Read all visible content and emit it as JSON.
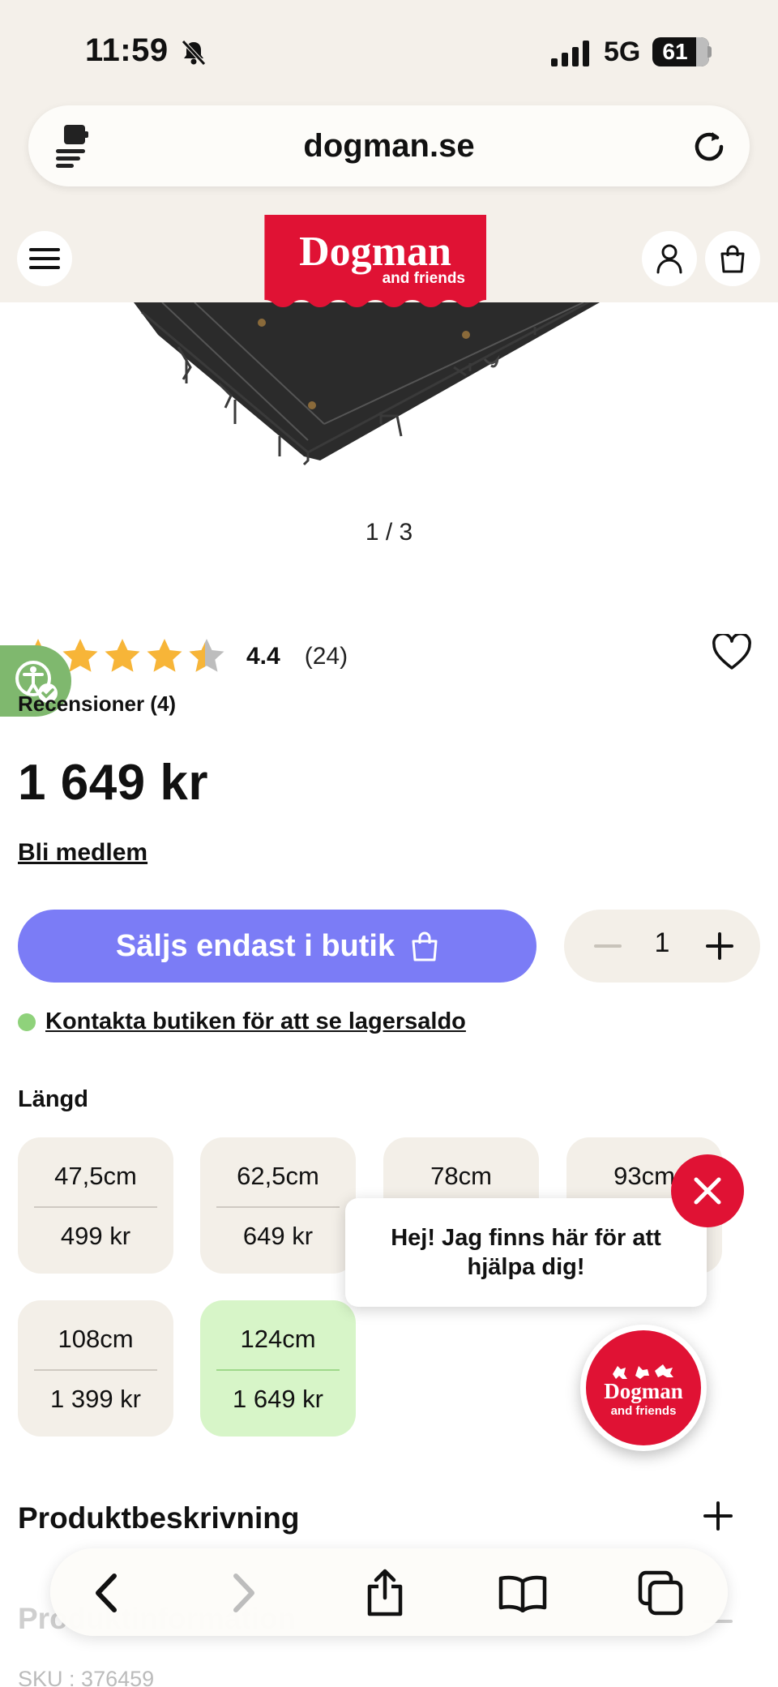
{
  "status_bar": {
    "time": "11:59",
    "network": "5G",
    "battery": "61",
    "icons": [
      "bell-slash-icon",
      "signal-icon",
      "battery-icon"
    ]
  },
  "browser": {
    "url": "dogman.se",
    "icons": [
      "reader-icon",
      "reload-icon"
    ]
  },
  "site_header": {
    "logo_main": "Dogman",
    "logo_sub": "and friends",
    "icons": [
      "menu-icon",
      "account-icon",
      "bag-icon"
    ],
    "brand_color": "#e01234"
  },
  "gallery": {
    "counter": "1 / 3"
  },
  "rating": {
    "value": "4.4",
    "count": "(24)",
    "stars": 4.4,
    "star_color": "#f7b538"
  },
  "reviews_label": "Recensioner (4)",
  "price": "1 649 kr",
  "member_link": "Bli medlem",
  "buy": {
    "button_label": "Säljs endast i butik",
    "button_color": "#7b7cf6",
    "quantity": "1"
  },
  "stock": {
    "link": "Kontakta butiken för att se lagersaldo",
    "dot_color": "#8fd27b"
  },
  "length": {
    "label": "Längd",
    "options": [
      {
        "length": "47,5cm",
        "price": "499 kr"
      },
      {
        "length": "62,5cm",
        "price": "649 kr"
      },
      {
        "length": "78cm",
        "price": ""
      },
      {
        "length": "93cm",
        "price": ""
      },
      {
        "length": "108cm",
        "price": "1 399 kr"
      },
      {
        "length": "124cm",
        "price": "1 649 kr",
        "selected": true
      }
    ]
  },
  "chat": {
    "message": "Hej! Jag finns här för att hjälpa dig!",
    "launcher_main": "Dogman",
    "launcher_sub": "and friends"
  },
  "sections": {
    "description": "Produktbeskrivning",
    "info": "Produktinformation",
    "sku_label": "SKU",
    "sku_value": ": 376459"
  }
}
